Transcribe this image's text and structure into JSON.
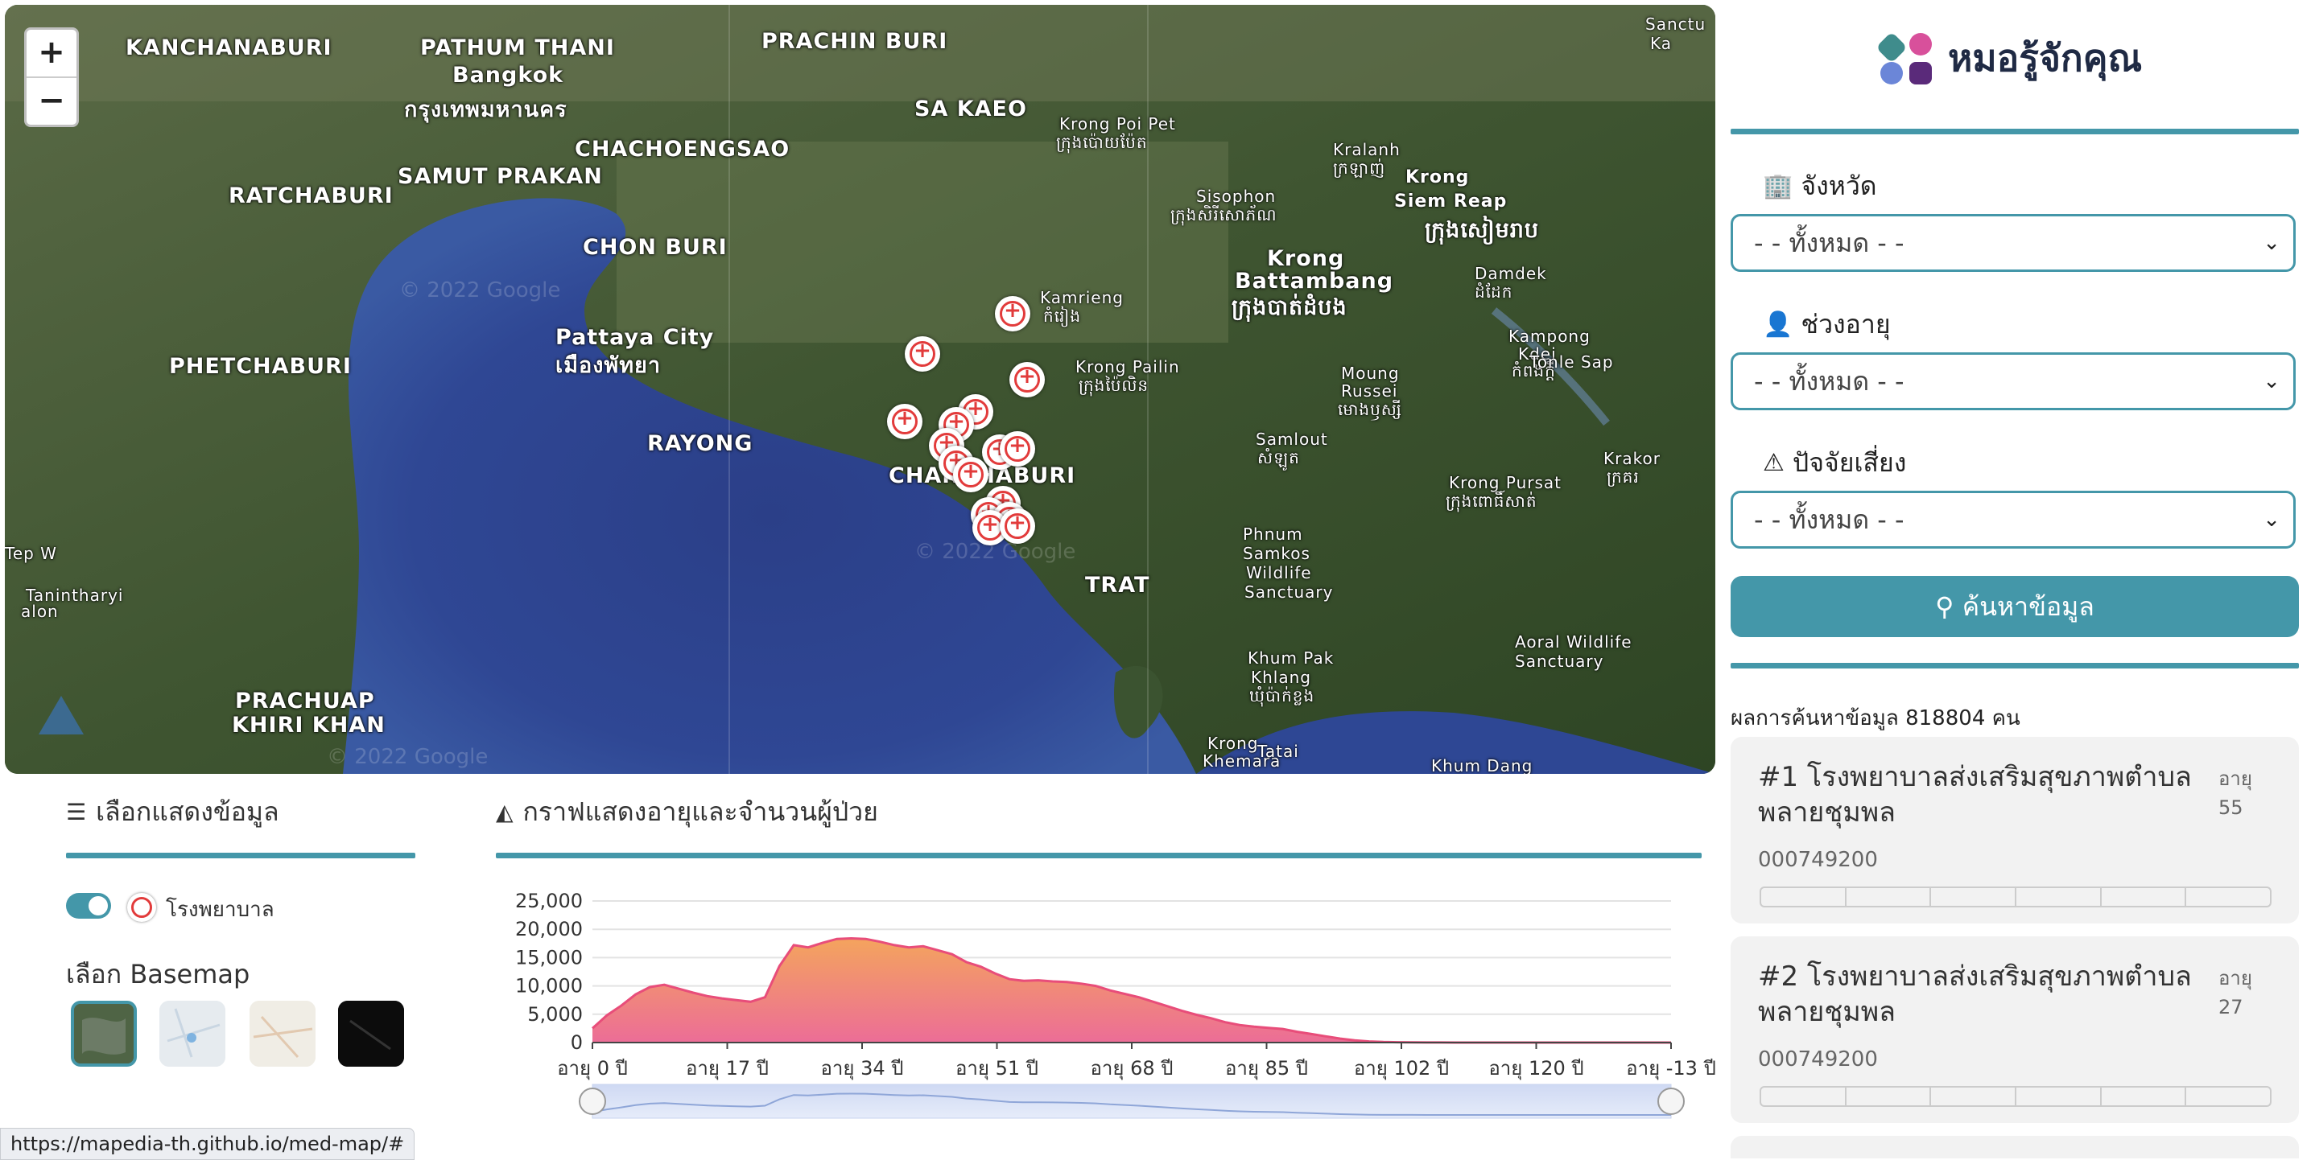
{
  "map": {
    "zoom_in": "+",
    "zoom_out": "−",
    "watermarks": [
      "© 2022 Google",
      "© 2022 Google",
      "© 2022 Google"
    ],
    "labels": [
      {
        "t": "KANCHANABURI",
        "c": "big"
      },
      {
        "t": "PATHUM THANI",
        "c": "big"
      },
      {
        "t": "Bangkok",
        "c": "big"
      },
      {
        "t": "กรุงเทพมหานคร",
        "c": "big"
      },
      {
        "t": "PRACHIN BURI",
        "c": "big"
      },
      {
        "t": "SA KAEO",
        "c": "big"
      },
      {
        "t": "CHACHOENGSAO",
        "c": "big"
      },
      {
        "t": "SAMUT PRAKAN",
        "c": "big"
      },
      {
        "t": "RATCHABURI",
        "c": "big"
      },
      {
        "t": "CHON BURI",
        "c": "big"
      },
      {
        "t": "PHETCHABURI",
        "c": "big"
      },
      {
        "t": "Pattaya City",
        "c": "big"
      },
      {
        "t": "เมืองพัทยา",
        "c": "big"
      },
      {
        "t": "RAYONG",
        "c": "big"
      },
      {
        "t": "CHANTHABURI",
        "c": "big"
      },
      {
        "t": "TRAT",
        "c": "big"
      },
      {
        "t": "PRACHUAP",
        "c": "big"
      },
      {
        "t": "KHIRI KHAN",
        "c": "big"
      },
      {
        "t": "Krong",
        "c": "big"
      },
      {
        "t": "Battambang",
        "c": "big"
      },
      {
        "t": "ក្រុងបាត់ដំបង",
        "c": "big"
      },
      {
        "t": "Krong",
        "c": "med"
      },
      {
        "t": "Siem Reap",
        "c": "med"
      },
      {
        "t": "ក្រុងសៀមរាប",
        "c": "big"
      },
      {
        "t": "Krong Poi Pet",
        "c": "sm"
      },
      {
        "t": "ក្រុងប៉ោយប៉ែត",
        "c": "sm"
      },
      {
        "t": "Sisophon",
        "c": "sm"
      },
      {
        "t": "ក្រុងសិរីសោភ័ណ",
        "c": "sm"
      },
      {
        "t": "Kralanh",
        "c": "sm"
      },
      {
        "t": "ក្រឡាញ់",
        "c": "sm"
      },
      {
        "t": "Kamrieng",
        "c": "sm"
      },
      {
        "t": "កំរៀង",
        "c": "sm"
      },
      {
        "t": "Krong Pailin",
        "c": "sm"
      },
      {
        "t": "ក្រុងប៉ៃលិន",
        "c": "sm"
      },
      {
        "t": "Moung",
        "c": "sm"
      },
      {
        "t": "Russei",
        "c": "sm"
      },
      {
        "t": "មោងឫស្សី",
        "c": "sm"
      },
      {
        "t": "Samlout",
        "c": "sm"
      },
      {
        "t": "សំឡូត",
        "c": "sm"
      },
      {
        "t": "Phnum",
        "c": "sm"
      },
      {
        "t": "Samkos",
        "c": "sm"
      },
      {
        "t": "Wildlife",
        "c": "sm"
      },
      {
        "t": "Sanctuary",
        "c": "sm"
      },
      {
        "t": "Krong Pursat",
        "c": "sm"
      },
      {
        "t": "ក្រុងពោធិ៍សាត់",
        "c": "sm"
      },
      {
        "t": "Krakor",
        "c": "sm"
      },
      {
        "t": "ក្រគរ",
        "c": "sm"
      },
      {
        "t": "Damdek",
        "c": "sm"
      },
      {
        "t": "ដំដែក",
        "c": "sm"
      },
      {
        "t": "Kampong",
        "c": "sm"
      },
      {
        "t": "Kdei",
        "c": "sm"
      },
      {
        "t": "កំពង់ក្ដី",
        "c": "sm"
      },
      {
        "t": "Tonle Sap",
        "c": "sm"
      },
      {
        "t": "Khum Pak",
        "c": "sm"
      },
      {
        "t": "Khlang",
        "c": "sm"
      },
      {
        "t": "ឃុំប៉ាក់ខ្លង",
        "c": "sm"
      },
      {
        "t": "Aoral Wildlife",
        "c": "sm"
      },
      {
        "t": "Sanctuary",
        "c": "sm"
      },
      {
        "t": "Krong",
        "c": "sm"
      },
      {
        "t": "Khemara",
        "c": "sm"
      },
      {
        "t": "Tatai",
        "c": "sm"
      },
      {
        "t": "Khum Dang",
        "c": "sm"
      },
      {
        "t": "Tanintharyi",
        "c": "sm"
      },
      {
        "t": "alon",
        "c": "sm"
      },
      {
        "t": "Tep W",
        "c": "sm"
      },
      {
        "t": "Sanctu",
        "c": "sm"
      },
      {
        "t": "Ka",
        "c": "sm"
      }
    ],
    "marker_count": 16
  },
  "sidebar": {
    "app_title": "หมอรู้จักคุณ",
    "filters": [
      {
        "icon": "🏢",
        "label": "จังหวัด",
        "value": "- - ทั้งหมด - -"
      },
      {
        "icon": "👤",
        "label": "ช่วงอายุ",
        "value": "- - ทั้งหมด - -"
      },
      {
        "icon": "⚠",
        "label": "ปัจจัยเสี่ยง",
        "value": "- - ทั้งหมด - -"
      }
    ],
    "search_label": "ค้นหาข้อมูล",
    "result_count": "ผลการค้นหาข้อมูล 818804 คน",
    "results": [
      {
        "title": "#1 โรงพยาบาลส่งเสริมสุขภาพตำบลพลายชุมพล",
        "age_label": "อายุ",
        "age": "55",
        "id": "000749200"
      },
      {
        "title": "#2 โรงพยาบาลส่งเสริมสุขภาพตำบลพลายชุมพล",
        "age_label": "อายุ",
        "age": "27",
        "id": "000749200"
      }
    ]
  },
  "layers_panel": {
    "title": "เลือกแสดงข้อมูล",
    "layer_label": "โรงพยาบาล",
    "layer_on": true,
    "basemap_title": "เลือก Basemap",
    "basemaps": [
      "satellite",
      "streets",
      "light",
      "dark"
    ]
  },
  "chart_panel": {
    "title": "กราฟแสดงอายุและจำนวนผู้ป่วย"
  },
  "chart_data": {
    "type": "area",
    "title": "กราฟแสดงอายุและจำนวนผู้ป่วย",
    "ylim": [
      0,
      25000
    ],
    "yticks": [
      "25,000",
      "20,000",
      "15,000",
      "10,000",
      "5,000",
      "0"
    ],
    "xticks": [
      "อายุ 0 ปี",
      "อายุ 17 ปี",
      "อายุ 34 ปี",
      "อายุ 51 ปี",
      "อายุ 68 ปี",
      "อายุ 85 ปี",
      "อายุ 102 ปี",
      "อายุ 120 ปี",
      "อายุ -13 ปี"
    ],
    "values": [
      2500,
      4800,
      6500,
      8500,
      9800,
      10200,
      9500,
      8800,
      8200,
      7800,
      7500,
      7200,
      8000,
      13500,
      17200,
      16800,
      17600,
      18300,
      18400,
      18300,
      17800,
      17200,
      16800,
      17000,
      16300,
      15600,
      14200,
      13400,
      12200,
      11200,
      10900,
      11000,
      10800,
      10700,
      10400,
      10000,
      9200,
      8600,
      8000,
      7200,
      6400,
      5600,
      4900,
      4300,
      3600,
      3100,
      2800,
      2600,
      2400,
      1900,
      1500,
      1100,
      700,
      400,
      200,
      100,
      60,
      40,
      20,
      10,
      5,
      0,
      0,
      0,
      0,
      0,
      0,
      0,
      0,
      0,
      0,
      0,
      0,
      0,
      0,
      0
    ],
    "colors": {
      "top": "#f4a45d",
      "bottom": "#ec6d97",
      "line": "#e84d7a"
    }
  },
  "status_url": "https://mapedia-th.github.io/med-map/#"
}
